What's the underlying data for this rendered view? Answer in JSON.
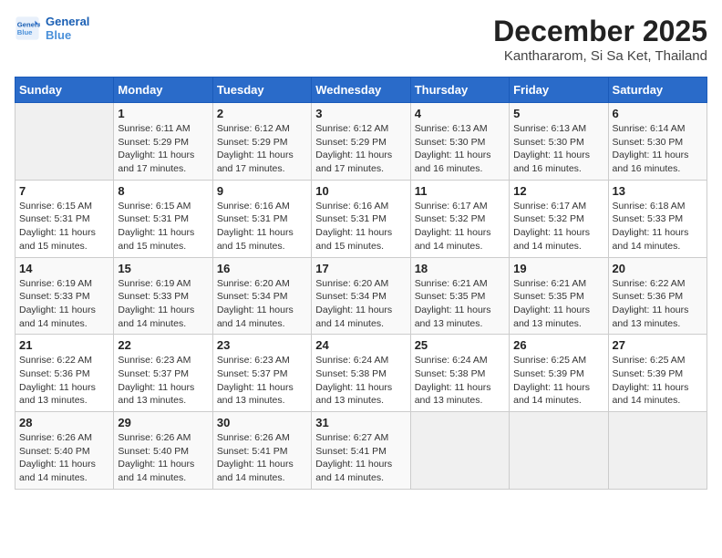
{
  "logo": {
    "line1": "General",
    "line2": "Blue"
  },
  "title": "December 2025",
  "location": "Kanthararom, Si Sa Ket, Thailand",
  "headers": [
    "Sunday",
    "Monday",
    "Tuesday",
    "Wednesday",
    "Thursday",
    "Friday",
    "Saturday"
  ],
  "weeks": [
    [
      {
        "day": "",
        "info": ""
      },
      {
        "day": "1",
        "info": "Sunrise: 6:11 AM\nSunset: 5:29 PM\nDaylight: 11 hours\nand 17 minutes."
      },
      {
        "day": "2",
        "info": "Sunrise: 6:12 AM\nSunset: 5:29 PM\nDaylight: 11 hours\nand 17 minutes."
      },
      {
        "day": "3",
        "info": "Sunrise: 6:12 AM\nSunset: 5:29 PM\nDaylight: 11 hours\nand 17 minutes."
      },
      {
        "day": "4",
        "info": "Sunrise: 6:13 AM\nSunset: 5:30 PM\nDaylight: 11 hours\nand 16 minutes."
      },
      {
        "day": "5",
        "info": "Sunrise: 6:13 AM\nSunset: 5:30 PM\nDaylight: 11 hours\nand 16 minutes."
      },
      {
        "day": "6",
        "info": "Sunrise: 6:14 AM\nSunset: 5:30 PM\nDaylight: 11 hours\nand 16 minutes."
      }
    ],
    [
      {
        "day": "7",
        "info": "Sunrise: 6:15 AM\nSunset: 5:31 PM\nDaylight: 11 hours\nand 15 minutes."
      },
      {
        "day": "8",
        "info": "Sunrise: 6:15 AM\nSunset: 5:31 PM\nDaylight: 11 hours\nand 15 minutes."
      },
      {
        "day": "9",
        "info": "Sunrise: 6:16 AM\nSunset: 5:31 PM\nDaylight: 11 hours\nand 15 minutes."
      },
      {
        "day": "10",
        "info": "Sunrise: 6:16 AM\nSunset: 5:31 PM\nDaylight: 11 hours\nand 15 minutes."
      },
      {
        "day": "11",
        "info": "Sunrise: 6:17 AM\nSunset: 5:32 PM\nDaylight: 11 hours\nand 14 minutes."
      },
      {
        "day": "12",
        "info": "Sunrise: 6:17 AM\nSunset: 5:32 PM\nDaylight: 11 hours\nand 14 minutes."
      },
      {
        "day": "13",
        "info": "Sunrise: 6:18 AM\nSunset: 5:33 PM\nDaylight: 11 hours\nand 14 minutes."
      }
    ],
    [
      {
        "day": "14",
        "info": "Sunrise: 6:19 AM\nSunset: 5:33 PM\nDaylight: 11 hours\nand 14 minutes."
      },
      {
        "day": "15",
        "info": "Sunrise: 6:19 AM\nSunset: 5:33 PM\nDaylight: 11 hours\nand 14 minutes."
      },
      {
        "day": "16",
        "info": "Sunrise: 6:20 AM\nSunset: 5:34 PM\nDaylight: 11 hours\nand 14 minutes."
      },
      {
        "day": "17",
        "info": "Sunrise: 6:20 AM\nSunset: 5:34 PM\nDaylight: 11 hours\nand 14 minutes."
      },
      {
        "day": "18",
        "info": "Sunrise: 6:21 AM\nSunset: 5:35 PM\nDaylight: 11 hours\nand 13 minutes."
      },
      {
        "day": "19",
        "info": "Sunrise: 6:21 AM\nSunset: 5:35 PM\nDaylight: 11 hours\nand 13 minutes."
      },
      {
        "day": "20",
        "info": "Sunrise: 6:22 AM\nSunset: 5:36 PM\nDaylight: 11 hours\nand 13 minutes."
      }
    ],
    [
      {
        "day": "21",
        "info": "Sunrise: 6:22 AM\nSunset: 5:36 PM\nDaylight: 11 hours\nand 13 minutes."
      },
      {
        "day": "22",
        "info": "Sunrise: 6:23 AM\nSunset: 5:37 PM\nDaylight: 11 hours\nand 13 minutes."
      },
      {
        "day": "23",
        "info": "Sunrise: 6:23 AM\nSunset: 5:37 PM\nDaylight: 11 hours\nand 13 minutes."
      },
      {
        "day": "24",
        "info": "Sunrise: 6:24 AM\nSunset: 5:38 PM\nDaylight: 11 hours\nand 13 minutes."
      },
      {
        "day": "25",
        "info": "Sunrise: 6:24 AM\nSunset: 5:38 PM\nDaylight: 11 hours\nand 13 minutes."
      },
      {
        "day": "26",
        "info": "Sunrise: 6:25 AM\nSunset: 5:39 PM\nDaylight: 11 hours\nand 14 minutes."
      },
      {
        "day": "27",
        "info": "Sunrise: 6:25 AM\nSunset: 5:39 PM\nDaylight: 11 hours\nand 14 minutes."
      }
    ],
    [
      {
        "day": "28",
        "info": "Sunrise: 6:26 AM\nSunset: 5:40 PM\nDaylight: 11 hours\nand 14 minutes."
      },
      {
        "day": "29",
        "info": "Sunrise: 6:26 AM\nSunset: 5:40 PM\nDaylight: 11 hours\nand 14 minutes."
      },
      {
        "day": "30",
        "info": "Sunrise: 6:26 AM\nSunset: 5:41 PM\nDaylight: 11 hours\nand 14 minutes."
      },
      {
        "day": "31",
        "info": "Sunrise: 6:27 AM\nSunset: 5:41 PM\nDaylight: 11 hours\nand 14 minutes."
      },
      {
        "day": "",
        "info": ""
      },
      {
        "day": "",
        "info": ""
      },
      {
        "day": "",
        "info": ""
      }
    ]
  ]
}
